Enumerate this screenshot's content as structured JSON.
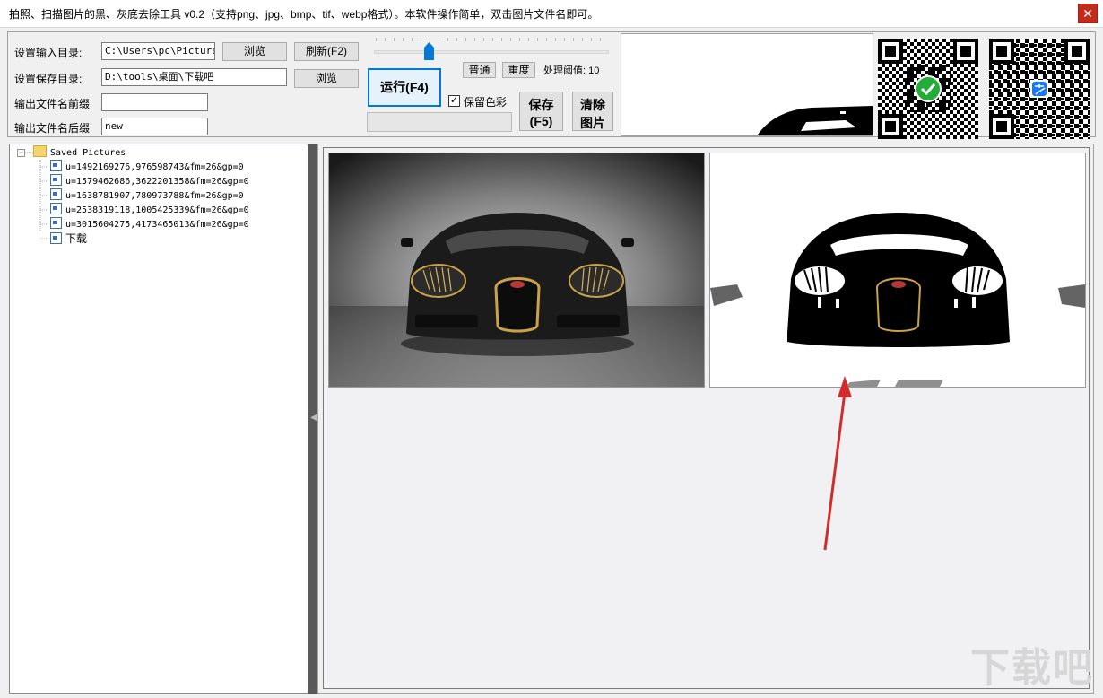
{
  "window": {
    "title": "拍照、扫描图片的黑、灰底去除工具 v0.2（支持png、jpg、bmp、tif、webp格式）。本软件操作简单，双击图片文件名即可。",
    "close_glyph": "✕"
  },
  "settings": {
    "input_dir_label": "设置输入目录:",
    "input_dir_value": "C:\\Users\\pc\\Pictures",
    "browse_label": "浏览",
    "refresh_label": "刷新(F2)",
    "save_dir_label": "设置保存目录:",
    "save_dir_value": "D:\\tools\\桌面\\下载吧",
    "browse2_label": "浏览",
    "prefix_label": "输出文件名前缀",
    "prefix_value": "",
    "suffix_label": "输出文件名后缀",
    "suffix_value": "new"
  },
  "controls": {
    "run_label": "运行(F4)",
    "normal_label": "普通",
    "heavy_label": "重度",
    "threshold_label": "处理阈值: 10",
    "threshold_value": 10,
    "keep_color_label": "保留色彩",
    "keep_color_checked": true,
    "save_label_line1": "保存",
    "save_label_line2": "(F5)",
    "clear_label_line1": "清除",
    "clear_label_line2": "图片"
  },
  "tree": {
    "root": "Saved Pictures",
    "expander": "−",
    "items": [
      "u=1492169276,976598743&fm=26&gp=0",
      "u=1579462686,3622201358&fm=26&gp=0",
      "u=1638781907,780973788&fm=26&gp=0",
      "u=2538319118,1005425339&fm=26&gp=0",
      "u=3015604275,4173465013&fm=26&gp=0",
      "下载"
    ]
  },
  "splitter": {
    "arrow": "◀"
  },
  "watermark": "下载吧",
  "colors": {
    "accent": "#0078d7",
    "close": "#c42b1c",
    "arrow": "#d22b2b"
  }
}
